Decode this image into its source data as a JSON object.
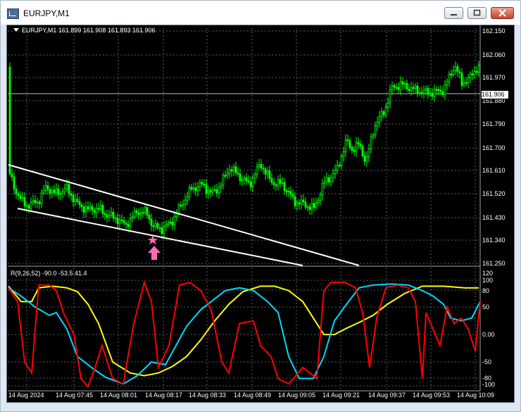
{
  "window": {
    "title": "EURJPY,M1"
  },
  "chart": {
    "info": "EURJPY,M1  161.899 161.908 161.893 161.906",
    "current_price": "161.906",
    "price_axis": [
      "162.150",
      "162.060",
      "161.970",
      "161.880",
      "161.790",
      "161.700",
      "161.610",
      "161.520",
      "161.430",
      "161.340",
      "161.250"
    ],
    "indicator_info": "R(9,26,52) -90.0 -53.5 41.4",
    "indicator_axis": [
      "120",
      "100",
      "80",
      "50",
      "0.00",
      "-50",
      "-80",
      "-100"
    ],
    "time_axis": [
      "14 Aug 2024",
      "14 Aug 07:45",
      "14 Aug 08:01",
      "14 Aug 08:17",
      "14 Aug 08:33",
      "14 Aug 08:49",
      "14 Aug 09:05",
      "14 Aug 09:21",
      "14 Aug 09:37",
      "14 Aug 09:53",
      "14 Aug 10:09"
    ],
    "colors": {
      "bull": "#00ff00",
      "bear": "#00ff00",
      "fast": "#ff0000",
      "medium": "#00d8ff",
      "slow": "#ffff00",
      "trendline": "#ffffff",
      "signal": "#ff69b4"
    }
  }
}
